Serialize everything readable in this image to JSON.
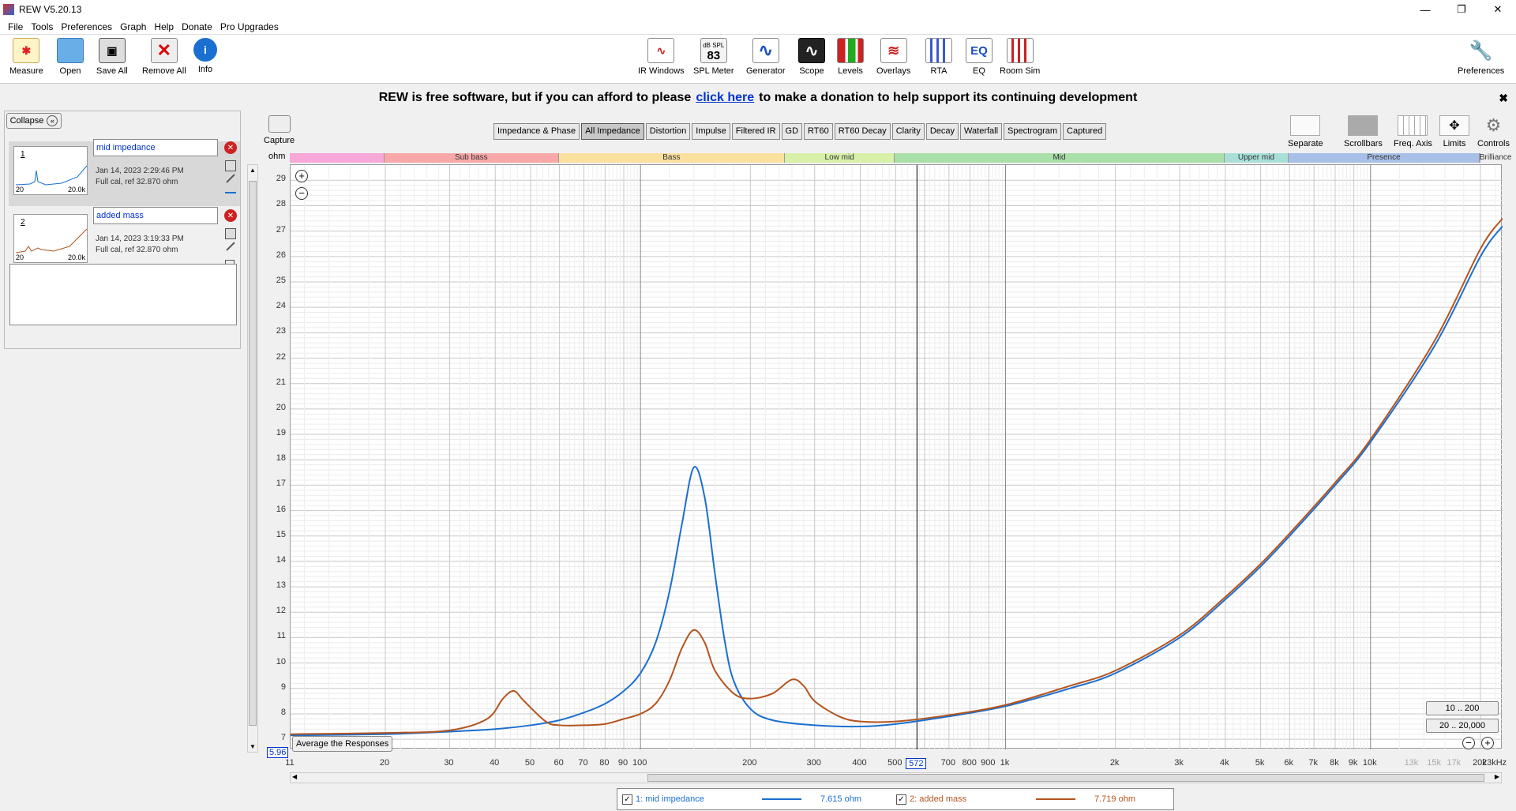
{
  "window": {
    "title": "REW V5.20.13",
    "minimize": "—",
    "restore": "❐",
    "close": "✕"
  },
  "menu": [
    "File",
    "Tools",
    "Preferences",
    "Graph",
    "Help",
    "Donate",
    "Pro Upgrades"
  ],
  "toolbar_left": [
    {
      "label": "Measure",
      "icon": "measure-icon"
    },
    {
      "label": "Open",
      "icon": "folder-icon"
    },
    {
      "label": "Save All",
      "icon": "save-icon"
    },
    {
      "label": "Remove All",
      "icon": "remove-icon"
    },
    {
      "label": "Info",
      "icon": "info-icon"
    }
  ],
  "toolbar_center": [
    {
      "label": "IR Windows",
      "icon": "ir-windows-icon"
    },
    {
      "label": "SPL Meter",
      "icon": "spl-meter-icon",
      "reading": "83",
      "unit": "dB SPL"
    },
    {
      "label": "Generator",
      "icon": "generator-icon"
    },
    {
      "label": "Scope",
      "icon": "scope-icon"
    },
    {
      "label": "Levels",
      "icon": "levels-icon"
    },
    {
      "label": "Overlays",
      "icon": "overlays-icon"
    },
    {
      "label": "RTA",
      "icon": "rta-icon"
    },
    {
      "label": "EQ",
      "icon": "eq-icon"
    },
    {
      "label": "Room Sim",
      "icon": "room-sim-icon"
    }
  ],
  "toolbar_right": {
    "label": "Preferences",
    "icon": "wrench-icon"
  },
  "donate": {
    "prefix": "REW is free software, but if you can afford to please",
    "link": "click here",
    "suffix": "to make a donation to help support its continuing development",
    "close": "✖"
  },
  "panel": {
    "collapse": "Collapse",
    "measurements": [
      {
        "num": "1",
        "name": "mid impedance",
        "date": "Jan 14, 2023 2:29:46 PM",
        "info": "Full cal, ref 32.870 ohm",
        "thumb_lo": "20",
        "thumb_hi": "20.0k",
        "color": "#1a6fd0"
      },
      {
        "num": "2",
        "name": "added mass",
        "date": "Jan 14, 2023 3:19:33 PM",
        "info": "Full cal, ref 32.870 ohm",
        "thumb_lo": "20",
        "thumb_hi": "20.0k",
        "color": "#b3541e"
      }
    ]
  },
  "capture_label": "Capture",
  "graph_tabs": [
    "Impedance & Phase",
    "All Impedance",
    "Distortion",
    "Impulse",
    "Filtered IR",
    "GD",
    "RT60",
    "RT60 Decay",
    "Clarity",
    "Decay",
    "Waterfall",
    "Spectrogram",
    "Captured"
  ],
  "selected_tab": "All Impedance",
  "graph_controls": [
    {
      "label": "Separate",
      "icon": "separate-icon"
    },
    {
      "label": "Scrollbars",
      "icon": "scrollbars-icon"
    },
    {
      "label": "Freq. Axis",
      "icon": "freq-axis-icon"
    },
    {
      "label": "Limits",
      "icon": "limits-icon"
    },
    {
      "label": "Controls",
      "icon": "gear-icon"
    }
  ],
  "bands": [
    {
      "label": "",
      "color": "#f8a8d8"
    },
    {
      "label": "Sub bass",
      "color": "#f8a8a8"
    },
    {
      "label": "Bass",
      "color": "#fbe0a0"
    },
    {
      "label": "Low mid",
      "color": "#d8f0a8"
    },
    {
      "label": "Mid",
      "color": "#a8e0a8"
    },
    {
      "label": "Upper mid",
      "color": "#a8e0d8"
    },
    {
      "label": "Presence",
      "color": "#a8c0e8"
    },
    {
      "label": "Brilliance",
      "color": "#c8b8e8"
    }
  ],
  "avg_button": "Average the Responses",
  "range_buttons": [
    "10 .. 200",
    "20 .. 20,000"
  ],
  "cursor": {
    "freq": "572",
    "value": "5.96"
  },
  "chart_data": {
    "type": "line",
    "title": "",
    "xlabel": "",
    "ylabel": "ohm",
    "x_scale": "log",
    "xlim": [
      11,
      23000
    ],
    "ylim": [
      6.6,
      29.6
    ],
    "x_ticks": [
      "11",
      "20",
      "30",
      "40",
      "50",
      "60",
      "70",
      "80",
      "90",
      "100",
      "200",
      "300",
      "400",
      "500",
      "572",
      "700",
      "800",
      "900",
      "1k",
      "2k",
      "3k",
      "4k",
      "5k",
      "6k",
      "7k",
      "8k",
      "9k",
      "10k",
      "13k",
      "15k",
      "17k",
      "20k",
      "23kHz"
    ],
    "y_ticks": [
      7,
      8,
      9,
      10,
      11,
      12,
      13,
      14,
      15,
      16,
      17,
      18,
      19,
      20,
      21,
      22,
      23,
      24,
      25,
      26,
      27,
      28,
      29
    ],
    "series": [
      {
        "name": "1: mid impedance",
        "value": "7.615 ohm",
        "color": "#1a6fd0",
        "x": [
          11,
          20,
          30,
          40,
          50,
          60,
          70,
          80,
          90,
          100,
          110,
          120,
          130,
          140,
          150,
          160,
          170,
          180,
          200,
          230,
          300,
          400,
          500,
          700,
          1000,
          1500,
          2000,
          3000,
          4000,
          5000,
          6000,
          8000,
          10000,
          15000,
          20000,
          23000
        ],
        "y": [
          7.15,
          7.2,
          7.3,
          7.4,
          7.55,
          7.75,
          8.05,
          8.4,
          8.9,
          9.6,
          10.8,
          12.8,
          15.5,
          17.7,
          16.5,
          13.5,
          10.9,
          9.3,
          8.2,
          7.75,
          7.55,
          7.5,
          7.6,
          7.9,
          8.3,
          9.0,
          9.6,
          11.0,
          12.5,
          13.8,
          15.0,
          17.0,
          18.7,
          22.5,
          26.0,
          27.2
        ]
      },
      {
        "name": "2: added mass",
        "value": "7.719 ohm",
        "color": "#b3541e",
        "x": [
          11,
          20,
          30,
          38,
          42,
          45,
          48,
          55,
          60,
          70,
          80,
          90,
          100,
          110,
          120,
          130,
          140,
          150,
          160,
          180,
          200,
          230,
          260,
          280,
          300,
          350,
          400,
          500,
          700,
          1000,
          1500,
          2000,
          3000,
          4000,
          5000,
          6000,
          8000,
          10000,
          15000,
          20000,
          23000
        ],
        "y": [
          7.2,
          7.25,
          7.35,
          7.8,
          8.6,
          8.9,
          8.5,
          7.7,
          7.55,
          7.55,
          7.6,
          7.8,
          8.0,
          8.4,
          9.3,
          10.6,
          11.3,
          10.8,
          9.7,
          8.8,
          8.6,
          8.8,
          9.35,
          9.1,
          8.5,
          7.9,
          7.7,
          7.7,
          7.95,
          8.35,
          9.1,
          9.7,
          11.1,
          12.6,
          13.9,
          15.1,
          17.1,
          18.8,
          22.7,
          26.3,
          27.5
        ]
      }
    ]
  }
}
